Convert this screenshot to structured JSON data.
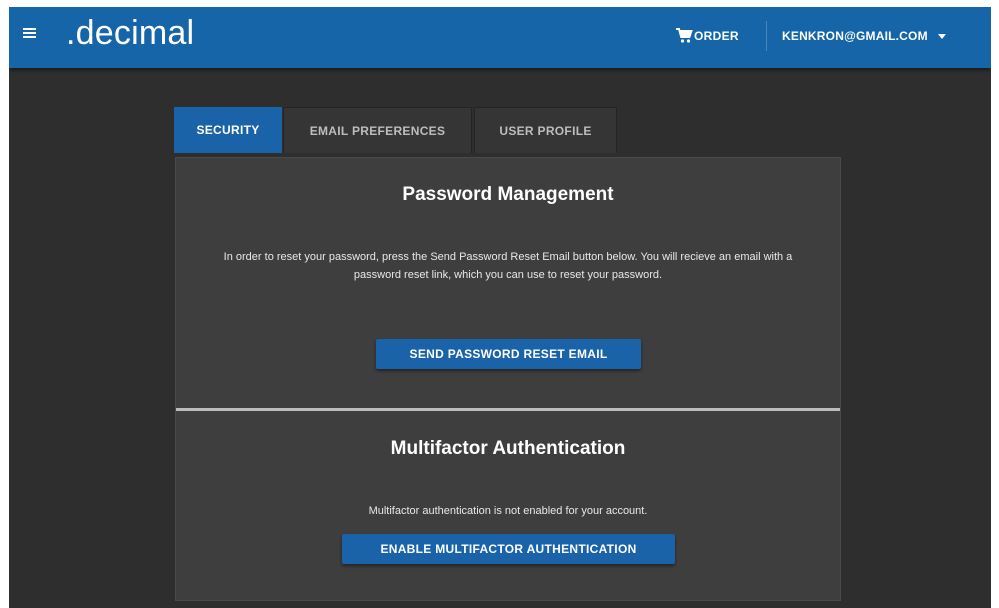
{
  "header": {
    "logo": ".decimal",
    "order_label": "ORDER",
    "account_label": "KENKRON@GMAIL.COM"
  },
  "icons": {
    "menu": "hamburger-menu-icon",
    "order": "shopping-cart-icon",
    "account": "chevron-down-icon"
  },
  "tabs": [
    {
      "label": "SECURITY",
      "active": true
    },
    {
      "label": "EMAIL PREFERENCES",
      "active": false
    },
    {
      "label": "USER PROFILE",
      "active": false
    }
  ],
  "password_section": {
    "title": "Password Management",
    "description": "In order to reset your password, press the Send Password Reset Email button below. You will recieve an email with a password reset link, which you can use to reset your password.",
    "button_label": "SEND PASSWORD RESET EMAIL"
  },
  "mfa_section": {
    "title": "Multifactor Authentication",
    "description": "Multifactor authentication is not enabled for your account.",
    "button_label": "ENABLE MULTIFACTOR AUTHENTICATION"
  },
  "colors": {
    "brand_blue": "#1565a8",
    "background": "#2e2e2e",
    "card": "#3e3e3e"
  }
}
